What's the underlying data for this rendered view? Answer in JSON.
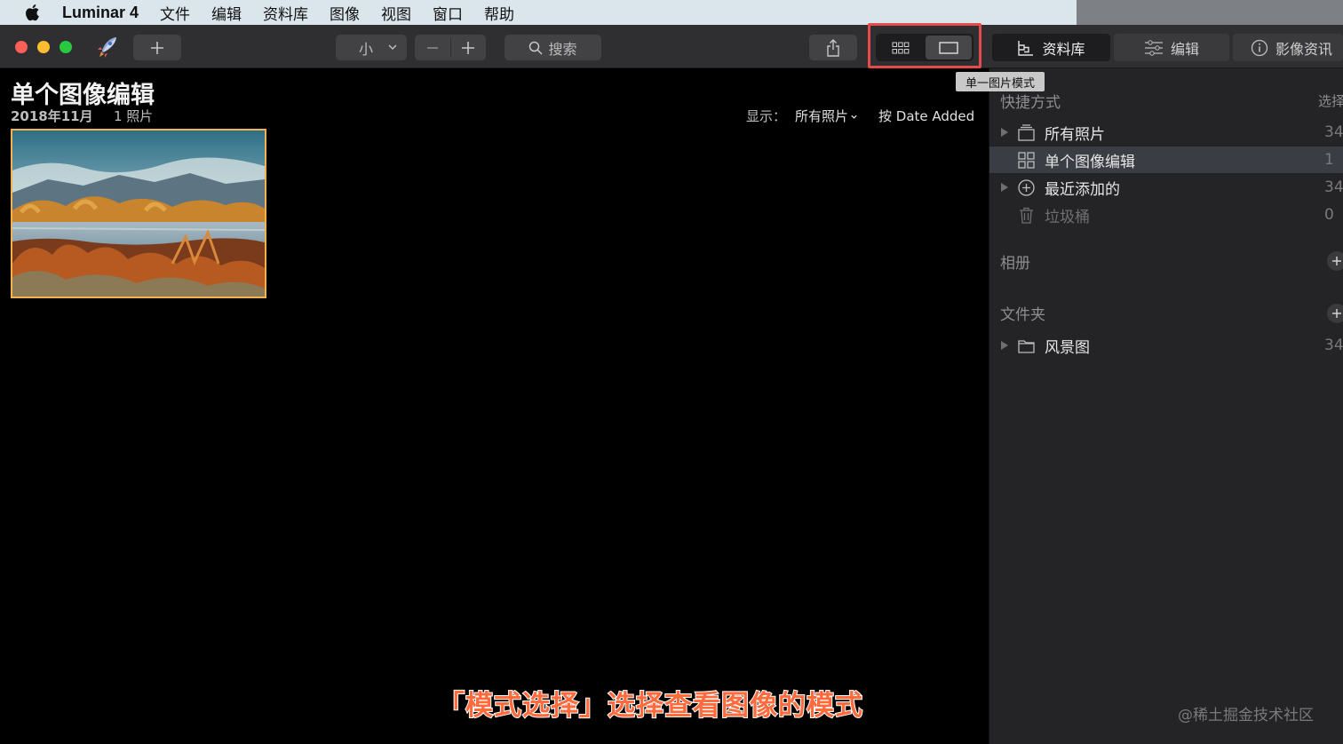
{
  "menubar": {
    "apple_icon": "apple-icon",
    "app_name": "Luminar 4",
    "items": [
      "文件",
      "编辑",
      "资料库",
      "图像",
      "视图",
      "窗口",
      "帮助"
    ]
  },
  "toolbar": {
    "add_icon": "plus-icon",
    "size_value": "小",
    "zoom_out_icon": "minus-icon",
    "zoom_in_icon": "plus-icon",
    "search_label": "搜索",
    "share_icon": "share-icon",
    "view_modes": [
      "grid-view-icon",
      "single-image-view-icon"
    ],
    "tabs": [
      {
        "label": "资料库",
        "icon": "library-icon"
      },
      {
        "label": "编辑",
        "icon": "sliders-icon"
      },
      {
        "label": "影像资讯",
        "icon": "info-icon"
      }
    ]
  },
  "tooltip": "单一图片模式",
  "main": {
    "title": "单个图像编辑",
    "date": "2018年11月",
    "count": "1 照片",
    "filter_label": "显示：",
    "filter_value": "所有照片",
    "sort_label": "按 Date Added",
    "caption": "「模式选择」选择查看图像的模式"
  },
  "sidebar": {
    "shortcuts_label": "快捷方式",
    "select_label": "选择",
    "shortcuts": [
      {
        "label": "所有照片",
        "count": "34",
        "icon": "photos-stack-icon",
        "expandable": true,
        "selected": false,
        "dim": false
      },
      {
        "label": "单个图像编辑",
        "count": "1",
        "icon": "grid-icon",
        "expandable": false,
        "selected": true,
        "dim": false
      },
      {
        "label": "最近添加的",
        "count": "34",
        "icon": "plus-circle-icon",
        "expandable": true,
        "selected": false,
        "dim": false
      },
      {
        "label": "垃圾桶",
        "count": "0",
        "icon": "trash-icon",
        "expandable": false,
        "selected": false,
        "dim": true
      }
    ],
    "albums_label": "相册",
    "folders_label": "文件夹",
    "folders": [
      {
        "label": "风景图",
        "count": "34",
        "icon": "folder-icon"
      }
    ]
  },
  "watermark": "@稀土掘金技术社区",
  "colors": {
    "accent_highlight": "#e44b4b",
    "selection_border": "#f2b24e",
    "caption": "#ff6b3d"
  }
}
